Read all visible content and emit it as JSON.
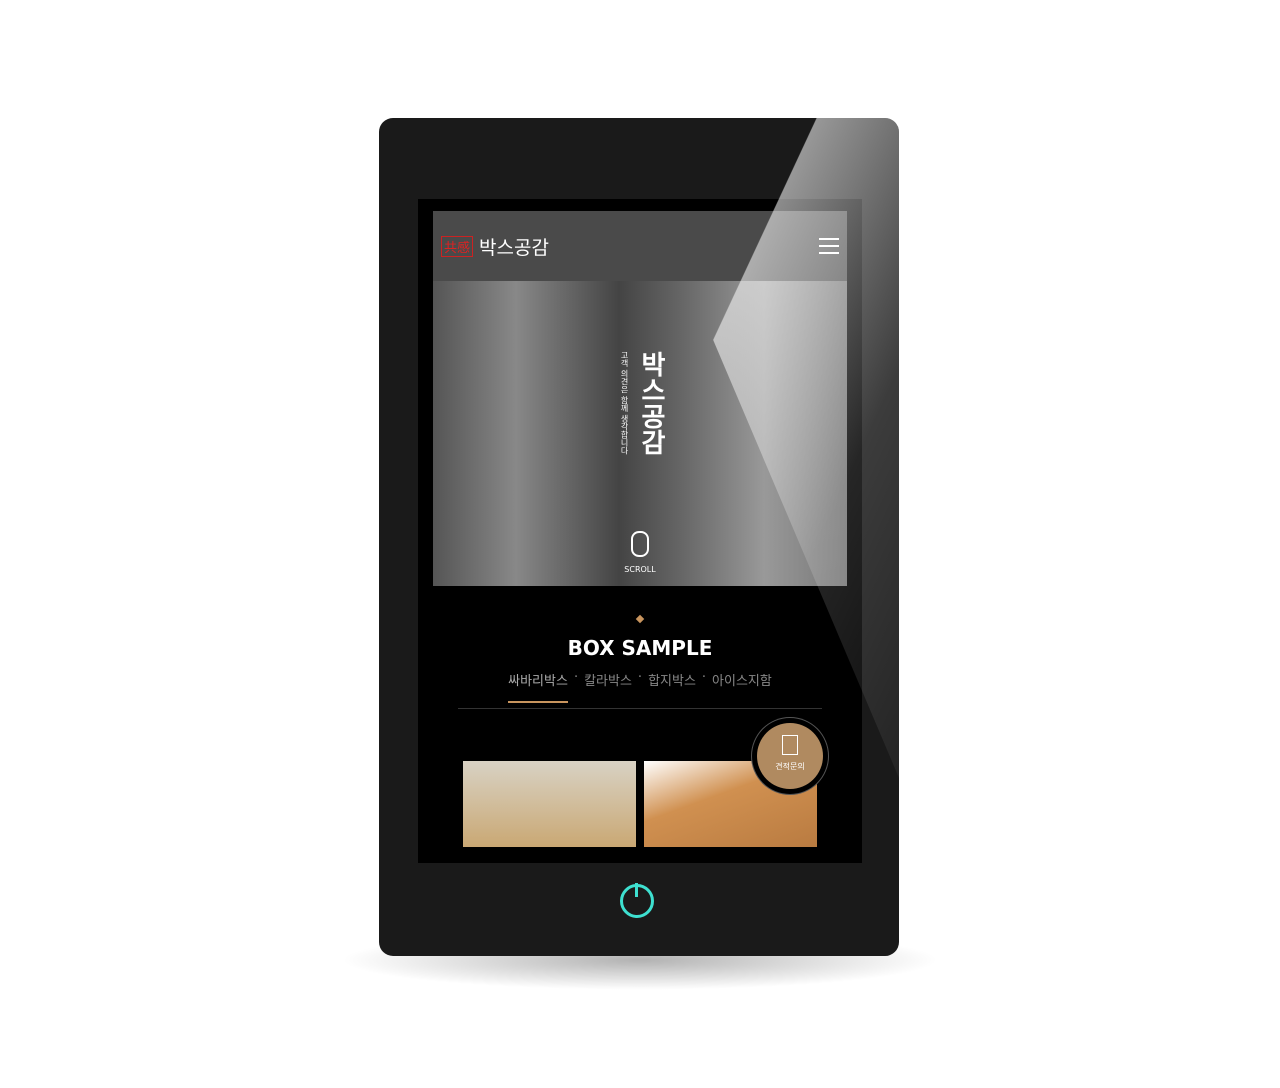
{
  "header": {
    "seal": "共感",
    "brand": "박스공감"
  },
  "hero": {
    "title": "박스공감",
    "subtitle": "고객 의견은 함께 생각합니다",
    "scroll": "SCROLL"
  },
  "section": {
    "title": "BOX SAMPLE",
    "tabs": [
      "싸바리박스",
      "칼라박스",
      "합지박스",
      "아이스지함"
    ],
    "sep": "·"
  },
  "quote_button": "견적문의"
}
